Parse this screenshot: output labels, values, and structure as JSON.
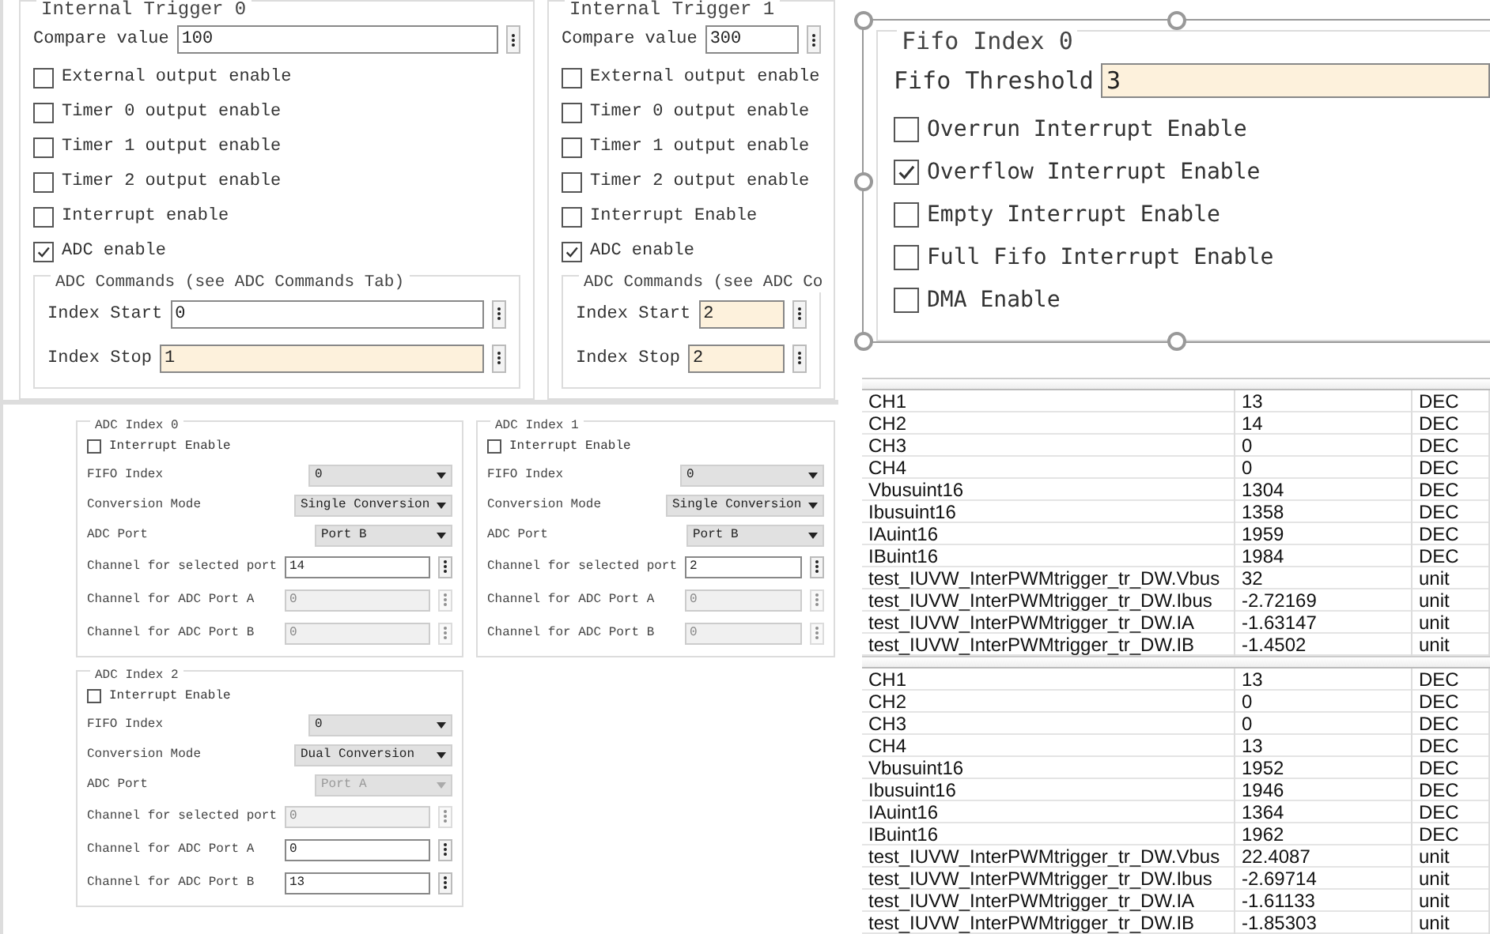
{
  "triggers": [
    {
      "title": "Internal Trigger 0",
      "compare": {
        "label": "Compare value",
        "value": "100",
        "modified": false
      },
      "checkboxes": [
        {
          "label": "External output enable",
          "checked": false
        },
        {
          "label": "Timer 0 output enable",
          "checked": false
        },
        {
          "label": "Timer 1 output enable",
          "checked": false
        },
        {
          "label": "Timer 2 output enable",
          "checked": false
        },
        {
          "label": "Interrupt enable",
          "checked": false
        },
        {
          "label": "ADC enable",
          "checked": true
        }
      ],
      "commands": {
        "title": "ADC Commands (see ADC Commands Tab)",
        "fields": [
          {
            "label": "Index Start",
            "value": "0",
            "modified": false
          },
          {
            "label": "Index Stop",
            "value": "1",
            "modified": true
          }
        ]
      }
    },
    {
      "title": "Internal Trigger 1",
      "compare": {
        "label": "Compare value",
        "value": "300",
        "modified": false
      },
      "checkboxes": [
        {
          "label": "External output enable",
          "checked": false
        },
        {
          "label": "Timer 0 output enable",
          "checked": false
        },
        {
          "label": "Timer 1 output enable",
          "checked": false
        },
        {
          "label": "Timer 2 output enable",
          "checked": false
        },
        {
          "label": "Interrupt Enable",
          "checked": false
        },
        {
          "label": "ADC enable",
          "checked": true
        }
      ],
      "commands": {
        "title": "ADC Commands (see ADC Co",
        "fields": [
          {
            "label": "Index Start",
            "value": "2",
            "modified": true
          },
          {
            "label": "Index Stop",
            "value": "2",
            "modified": true
          }
        ]
      }
    }
  ],
  "adc_indices": [
    {
      "title": "ADC Index 0",
      "interrupt": {
        "label": "Interrupt Enable",
        "checked": false
      },
      "fields": [
        {
          "kind": "select",
          "label": "FIFO Index",
          "value": "0",
          "disabled": false
        },
        {
          "kind": "select",
          "label": "Conversion Mode",
          "value": "Single Conversion",
          "disabled": false
        },
        {
          "kind": "select",
          "label": "ADC Port",
          "value": "Port B",
          "disabled": false
        },
        {
          "kind": "spin",
          "label": "Channel for selected port",
          "value": "14",
          "disabled": false
        },
        {
          "kind": "spin",
          "label": "Channel for ADC Port A",
          "value": "0",
          "disabled": true
        },
        {
          "kind": "spin",
          "label": "Channel for ADC Port B",
          "value": "0",
          "disabled": true
        }
      ]
    },
    {
      "title": "ADC Index 1",
      "interrupt": {
        "label": "Interrupt Enable",
        "checked": false
      },
      "fields": [
        {
          "kind": "select",
          "label": "FIFO Index",
          "value": "0",
          "disabled": false
        },
        {
          "kind": "select",
          "label": "Conversion Mode",
          "value": "Single Conversion",
          "disabled": false
        },
        {
          "kind": "select",
          "label": "ADC Port",
          "value": "Port B",
          "disabled": false
        },
        {
          "kind": "spin",
          "label": "Channel for selected port",
          "value": "2",
          "disabled": false
        },
        {
          "kind": "spin",
          "label": "Channel for ADC Port A",
          "value": "0",
          "disabled": true
        },
        {
          "kind": "spin",
          "label": "Channel for ADC Port B",
          "value": "0",
          "disabled": true
        }
      ]
    },
    {
      "title": "ADC Index 2",
      "interrupt": {
        "label": "Interrupt Enable",
        "checked": false
      },
      "fields": [
        {
          "kind": "select",
          "label": "FIFO Index",
          "value": "0",
          "disabled": false
        },
        {
          "kind": "select",
          "label": "Conversion Mode",
          "value": "Dual Conversion",
          "disabled": false
        },
        {
          "kind": "select",
          "label": "ADC Port",
          "value": "Port A",
          "disabled": true
        },
        {
          "kind": "spin",
          "label": "Channel for selected port",
          "value": "0",
          "disabled": true
        },
        {
          "kind": "spin",
          "label": "Channel for ADC Port A",
          "value": "0",
          "disabled": false
        },
        {
          "kind": "spin",
          "label": "Channel for ADC Port B",
          "value": "13",
          "disabled": false
        }
      ]
    }
  ],
  "fifo": {
    "title": "Fifo Index 0",
    "threshold": {
      "label": "Fifo Threshold",
      "value": "3",
      "modified": true
    },
    "checkboxes": [
      {
        "label": "Overrun Interrupt Enable",
        "checked": false
      },
      {
        "label": "Overflow Interrupt Enable",
        "checked": true
      },
      {
        "label": "Empty Interrupt Enable",
        "checked": false
      },
      {
        "label": "Full Fifo Interrupt Enable",
        "checked": false
      },
      {
        "label": "DMA Enable",
        "checked": false
      }
    ]
  },
  "tables": [
    {
      "rows": [
        {
          "name": "CH1",
          "value": "13",
          "format": "DEC"
        },
        {
          "name": "CH2",
          "value": "14",
          "format": "DEC"
        },
        {
          "name": "CH3",
          "value": "0",
          "format": "DEC"
        },
        {
          "name": "CH4",
          "value": "0",
          "format": "DEC"
        },
        {
          "name": "Vbusuint16",
          "value": "1304",
          "format": "DEC"
        },
        {
          "name": "Ibusuint16",
          "value": "1358",
          "format": "DEC"
        },
        {
          "name": "IAuint16",
          "value": "1959",
          "format": "DEC"
        },
        {
          "name": "IBuint16",
          "value": "1984",
          "format": "DEC"
        },
        {
          "name": "test_IUVW_InterPWMtrigger_tr_DW.Vbus",
          "value": "32",
          "format": "unit"
        },
        {
          "name": "test_IUVW_InterPWMtrigger_tr_DW.Ibus",
          "value": "-2.72169",
          "format": "unit"
        },
        {
          "name": "test_IUVW_InterPWMtrigger_tr_DW.IA",
          "value": "-1.63147",
          "format": "unit"
        },
        {
          "name": "test_IUVW_InterPWMtrigger_tr_DW.IB",
          "value": "-1.4502",
          "format": "unit"
        }
      ]
    },
    {
      "rows": [
        {
          "name": "CH1",
          "value": "13",
          "format": "DEC"
        },
        {
          "name": "CH2",
          "value": "0",
          "format": "DEC"
        },
        {
          "name": "CH3",
          "value": "0",
          "format": "DEC"
        },
        {
          "name": "CH4",
          "value": "13",
          "format": "DEC"
        },
        {
          "name": "Vbusuint16",
          "value": "1952",
          "format": "DEC"
        },
        {
          "name": "Ibusuint16",
          "value": "1946",
          "format": "DEC"
        },
        {
          "name": "IAuint16",
          "value": "1364",
          "format": "DEC"
        },
        {
          "name": "IBuint16",
          "value": "1962",
          "format": "DEC"
        },
        {
          "name": "test_IUVW_InterPWMtrigger_tr_DW.Vbus",
          "value": "22.4087",
          "format": "unit"
        },
        {
          "name": "test_IUVW_InterPWMtrigger_tr_DW.Ibus",
          "value": "-2.69714",
          "format": "unit"
        },
        {
          "name": "test_IUVW_InterPWMtrigger_tr_DW.IA",
          "value": "-1.61133",
          "format": "unit"
        },
        {
          "name": "test_IUVW_InterPWMtrigger_tr_DW.IB",
          "value": "-1.85303",
          "format": "unit"
        }
      ]
    }
  ]
}
